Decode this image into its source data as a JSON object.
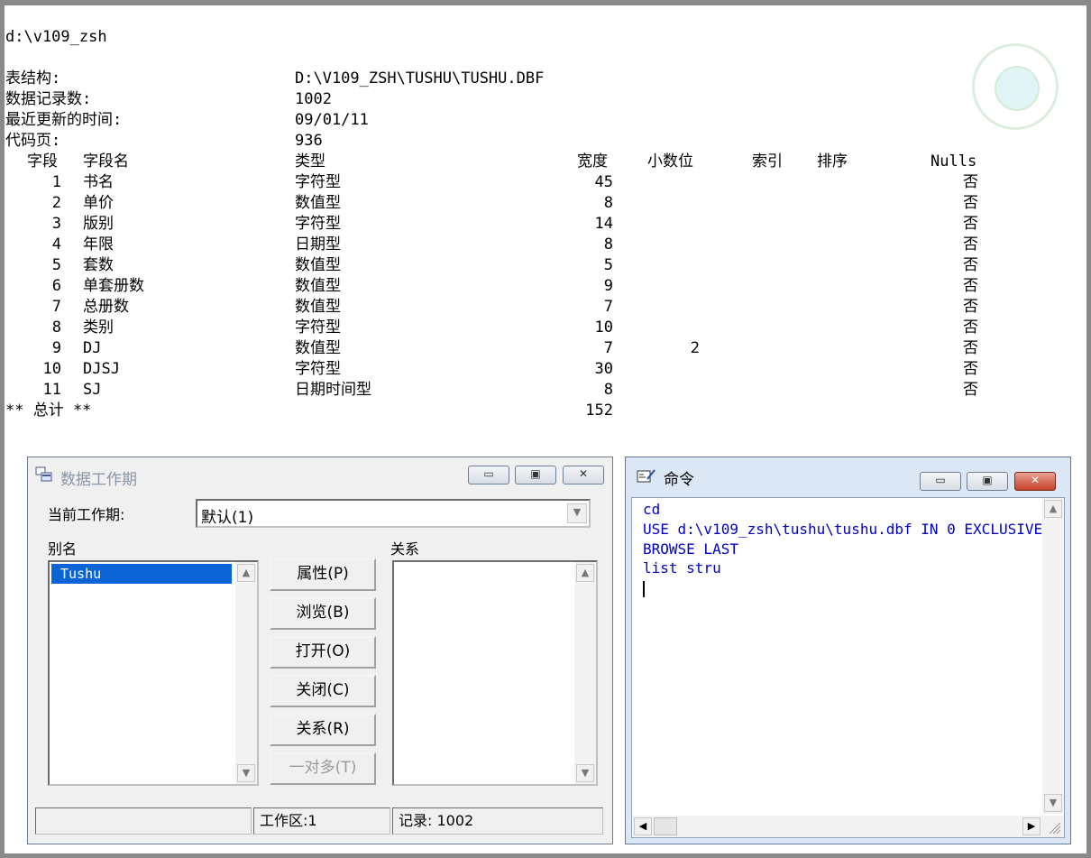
{
  "path_line": "d:\\v109_zsh",
  "info": {
    "struct_label": "表结构:",
    "struct_value": "D:\\V109_ZSH\\TUSHU\\TUSHU.DBF",
    "records_label": "数据记录数:",
    "records_value": "1002",
    "updated_label": "最近更新的时间:",
    "updated_value": "09/01/11",
    "codepage_label": "代码页:",
    "codepage_value": "936"
  },
  "table": {
    "headers": {
      "field": "字段",
      "name": "字段名",
      "type": "类型",
      "width": "宽度",
      "decimal": "小数位",
      "index": "索引",
      "sort": "排序",
      "nulls": "Nulls"
    },
    "rows": [
      {
        "no": "1",
        "name": "书名",
        "type": "字符型",
        "width": "45",
        "decimal": "",
        "nulls": "否"
      },
      {
        "no": "2",
        "name": "单价",
        "type": "数值型",
        "width": "8",
        "decimal": "",
        "nulls": "否"
      },
      {
        "no": "3",
        "name": "版别",
        "type": "字符型",
        "width": "14",
        "decimal": "",
        "nulls": "否"
      },
      {
        "no": "4",
        "name": "年限",
        "type": "日期型",
        "width": "8",
        "decimal": "",
        "nulls": "否"
      },
      {
        "no": "5",
        "name": "套数",
        "type": "数值型",
        "width": "5",
        "decimal": "",
        "nulls": "否"
      },
      {
        "no": "6",
        "name": "单套册数",
        "type": "数值型",
        "width": "9",
        "decimal": "",
        "nulls": "否"
      },
      {
        "no": "7",
        "name": "总册数",
        "type": "数值型",
        "width": "7",
        "decimal": "",
        "nulls": "否"
      },
      {
        "no": "8",
        "name": "类别",
        "type": "字符型",
        "width": "10",
        "decimal": "",
        "nulls": "否"
      },
      {
        "no": "9",
        "name": "DJ",
        "type": "数值型",
        "width": "7",
        "decimal": "2",
        "nulls": "否"
      },
      {
        "no": "10",
        "name": "DJSJ",
        "type": "字符型",
        "width": "30",
        "decimal": "",
        "nulls": "否"
      },
      {
        "no": "11",
        "name": "SJ",
        "type": "日期时间型",
        "width": "8",
        "decimal": "",
        "nulls": "否"
      }
    ],
    "total_label": "** 总计 **",
    "total_value": "152"
  },
  "datasession": {
    "title": "数据工作期",
    "current_label": "当前工作期:",
    "current_value": "默认(1)",
    "alias_label": "别名",
    "alias_items": [
      "Tushu"
    ],
    "relation_label": "关系",
    "buttons": [
      "属性(P)",
      "浏览(B)",
      "打开(O)",
      "关闭(C)",
      "关系(R)",
      "一对多(T)"
    ],
    "status_workarea": "工作区:1",
    "status_record": "记录: 1002"
  },
  "command": {
    "title": "命令",
    "lines": [
      "cd",
      "USE d:\\v109_zsh\\tushu\\tushu.dbf IN 0 EXCLUSIVE",
      "BROWSE LAST",
      "list stru"
    ]
  },
  "colors": {
    "selection": "#0a64d6",
    "command_text": "#0000c8",
    "window_frame": "#6d7b8c"
  }
}
